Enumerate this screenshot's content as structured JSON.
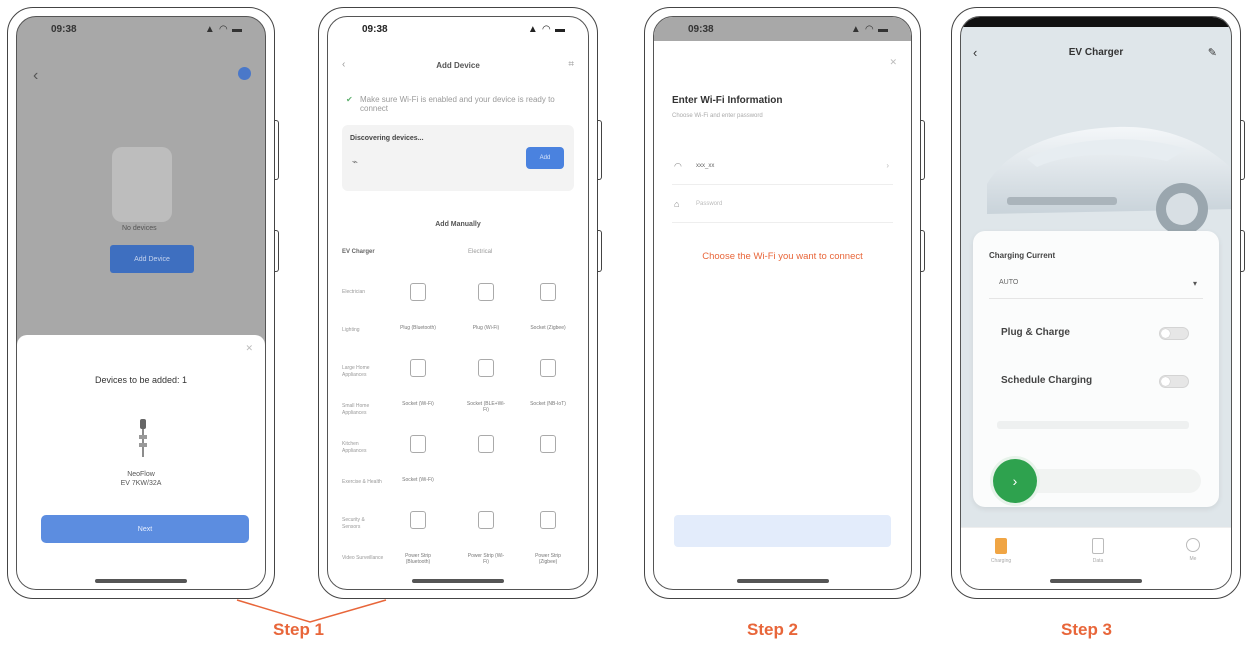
{
  "phones": {
    "p1": {
      "time": "09:38",
      "sheet_title": "Devices to be added: 1",
      "device_name_line1": "NeoFlow",
      "device_name_line2": "EV 7KW/32A",
      "next_label": "Next",
      "blue_button": "Add Device",
      "device_caption": "No devices"
    },
    "p2": {
      "time": "09:38",
      "title": "Add Device",
      "scan_note": "Make sure Wi-Fi is enabled and your device is ready to connect",
      "card_title": "Discovering devices...",
      "card_button": "Add",
      "add_manually": "Add Manually",
      "category": "EV Charger",
      "subtitle": "Electrical",
      "rows": [
        {
          "label": "Electrician",
          "caps": [
            "",
            "",
            ""
          ]
        },
        {
          "label": "Lighting",
          "caps": [
            "Plug (Bluetooth)",
            "Plug (Wi-Fi)",
            "Socket (Zigbee)"
          ]
        },
        {
          "label": "Large Home Appliances",
          "caps": [
            "",
            "",
            ""
          ]
        },
        {
          "label": "Small Home Appliances",
          "caps": [
            "Socket (Wi-Fi)",
            "Socket (BLE+Wi-Fi)",
            "Socket (NB-IoT)"
          ]
        },
        {
          "label": "Kitchen Appliances",
          "caps": [
            "Socket",
            "",
            ""
          ]
        },
        {
          "label": "Exercise & Health",
          "caps": [
            "Socket (Wi-Fi)",
            "",
            ""
          ]
        },
        {
          "label": "Security & Sensors",
          "caps": [
            "",
            "",
            ""
          ]
        },
        {
          "label": "Video Surveillance",
          "caps": [
            "Power Strip (Bluetooth)",
            "Power Strip (Wi-Fi)",
            "Power Strip (Zigbee)"
          ]
        }
      ]
    },
    "p3": {
      "time": "09:38",
      "title": "Enter Wi-Fi Information",
      "subtitle": "Choose Wi-Fi and enter password",
      "ssid": "xxx_xx",
      "password_placeholder": "Password",
      "hint": "Choose the Wi-Fi you want to connect"
    },
    "p4": {
      "title": "EV Charger",
      "charging_current_label": "Charging Current",
      "charging_current_value": "AUTO",
      "plug_charge_label": "Plug & Charge",
      "schedule_label": "Schedule Charging",
      "tabs": [
        "Charging",
        "Data",
        "Me"
      ]
    }
  },
  "steps": {
    "step1": "Step 1",
    "step2": "Step 2",
    "step3": "Step 3"
  },
  "colors": {
    "accent": "#e8663a",
    "blue": "#5c8de0",
    "green": "#2ea24e"
  }
}
